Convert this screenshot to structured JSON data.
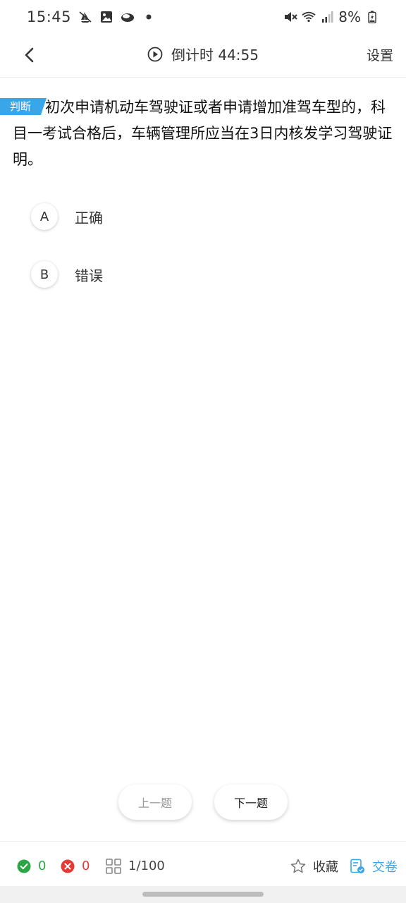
{
  "status_bar": {
    "time": "15:45",
    "battery": "8%",
    "left_icons": [
      "silent-sailboat-icon",
      "image-icon",
      "cloud-icon",
      "dot-icon"
    ],
    "right_icons": [
      "mute-icon",
      "wifi-icon",
      "signal-icon",
      "battery-icon"
    ]
  },
  "header": {
    "timer_label": "倒计时 44:55",
    "settings_label": "设置"
  },
  "question": {
    "tag": "判断",
    "text": "初次申请机动车驾驶证或者申请增加准驾车型的，科目一考试合格后，车辆管理所应当在3日内核发学习驾驶证明。"
  },
  "options": [
    {
      "letter": "A",
      "label": "正确"
    },
    {
      "letter": "B",
      "label": "错误"
    }
  ],
  "nav": {
    "prev_label": "上一题",
    "next_label": "下一题"
  },
  "bottom": {
    "correct_count": "0",
    "wrong_count": "0",
    "progress": "1/100",
    "collect_label": "收藏",
    "submit_label": "交卷"
  },
  "colors": {
    "accent": "#3aa6ea",
    "correct": "#2aa646",
    "wrong": "#e53935"
  }
}
